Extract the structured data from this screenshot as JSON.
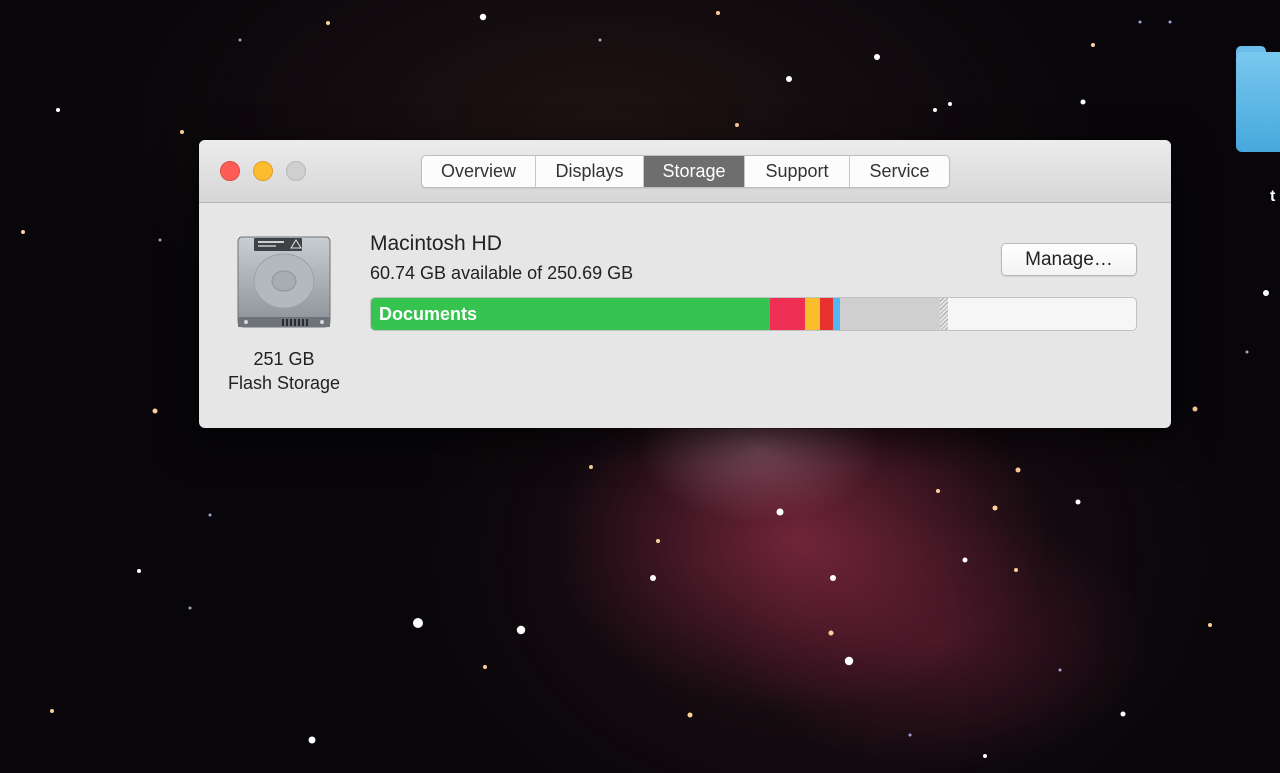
{
  "desktop": {
    "folder_label": "t"
  },
  "window": {
    "tabs": [
      {
        "label": "Overview"
      },
      {
        "label": "Displays"
      },
      {
        "label": "Storage",
        "selected": true
      },
      {
        "label": "Support"
      },
      {
        "label": "Service"
      }
    ]
  },
  "disk": {
    "size": "251 GB",
    "type": "Flash Storage"
  },
  "volume": {
    "name": "Macintosh HD",
    "available_text": "60.74 GB available of 250.69 GB",
    "available_gb": 60.74,
    "capacity_gb": 250.69,
    "manage_label": "Manage…"
  },
  "storage_bar": {
    "segments": [
      {
        "key": "documents",
        "label": "Documents",
        "color": "#34c44f",
        "gb": 130.7
      },
      {
        "key": "category-red",
        "label": "",
        "color": "#ef2f54",
        "gb": 11.5
      },
      {
        "key": "category-yellow",
        "label": "",
        "color": "#f8be2c",
        "gb": 4.9
      },
      {
        "key": "category-red-2",
        "label": "",
        "color": "#e8312f",
        "gb": 4.3
      },
      {
        "key": "category-blue",
        "label": "",
        "color": "#53b6f2",
        "gb": 2.3
      },
      {
        "key": "category-gray",
        "label": "",
        "color": "#cfcfcf",
        "gb": 32.8
      },
      {
        "key": "category-purgeable",
        "label": "",
        "color": "hatch",
        "gb": 2.6
      }
    ]
  }
}
